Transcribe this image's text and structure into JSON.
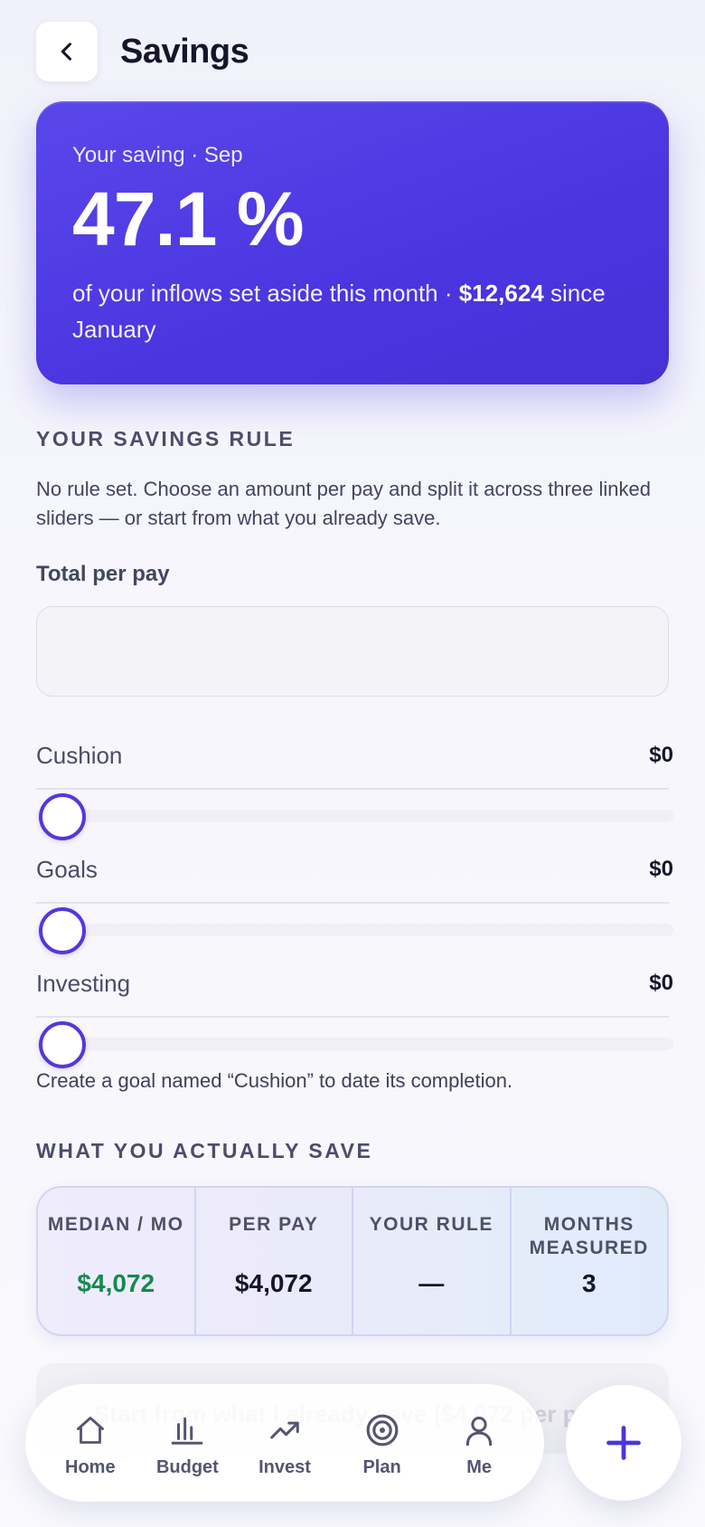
{
  "header": {
    "title": "Savings"
  },
  "hero": {
    "label": "Your saving · Sep",
    "value": "47.1 %",
    "desc_prefix": "of your inflows set aside this month · ",
    "desc_amount": "$12,624",
    "desc_suffix": " since January"
  },
  "rule": {
    "heading": "YOUR SAVINGS RULE",
    "description": "No rule set. Choose an amount per pay and split it across three linked sliders — or start from what you already save.",
    "total_label": "Total per pay",
    "total_value": "",
    "total_placeholder": "",
    "sliders": [
      {
        "name": "Cushion",
        "amount": "$0",
        "level": 0
      },
      {
        "name": "Goals",
        "amount": "$0",
        "level": 0
      },
      {
        "name": "Investing",
        "amount": "$0",
        "level": 0
      }
    ],
    "note": "Create a goal named “Cushion” to date its completion."
  },
  "actual": {
    "heading": "WHAT YOU ACTUALLY SAVE",
    "stats": [
      {
        "label": "MEDIAN / MO",
        "value": "$4,072",
        "color": "#138a4d"
      },
      {
        "label": "PER PAY",
        "value": "$4,072"
      },
      {
        "label": "YOUR RULE",
        "value": "—"
      },
      {
        "label": "MONTHS MEASURED",
        "value": "3"
      }
    ],
    "start_button": "Start from what I already save ($4,072 per pay)"
  },
  "nav": {
    "items": [
      {
        "label": "Home",
        "icon": "home-icon"
      },
      {
        "label": "Budget",
        "icon": "bar-chart-icon"
      },
      {
        "label": "Invest",
        "icon": "trending-up-icon"
      },
      {
        "label": "Plan",
        "icon": "target-icon"
      },
      {
        "label": "Me",
        "icon": "user-icon"
      }
    ],
    "fab_icon": "plus-icon"
  },
  "colors": {
    "accent": "#4a35e0",
    "positive": "#138a4d"
  }
}
